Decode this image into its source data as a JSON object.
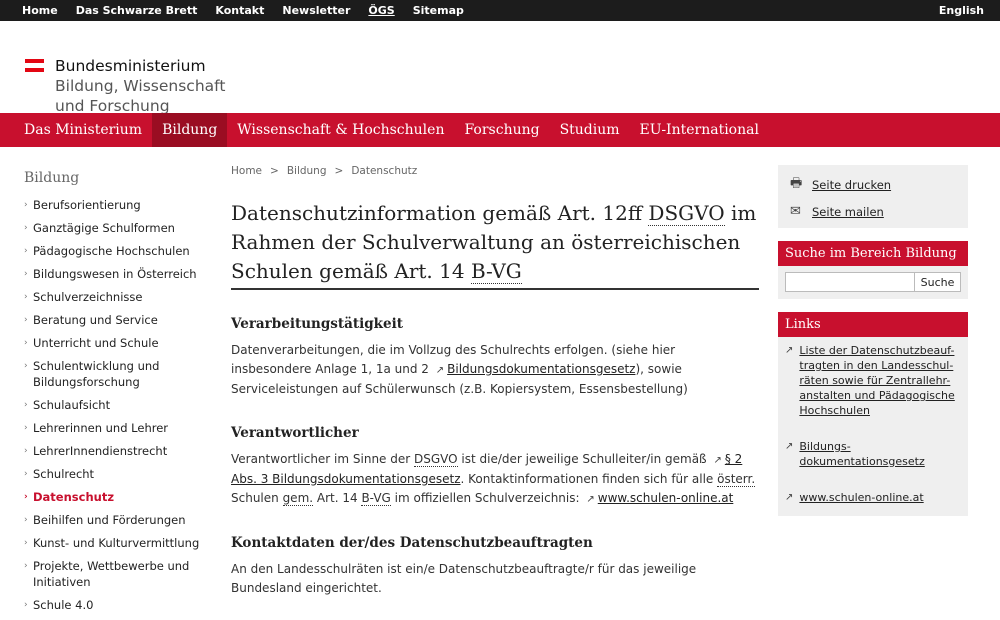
{
  "topbar": {
    "links": [
      "Home",
      "Das Schwarze Brett",
      "Kontakt",
      "Newsletter",
      "ÖGS",
      "Sitemap"
    ],
    "language": "English"
  },
  "logo": {
    "line1": "Bundesministerium",
    "line2": "Bildung, Wissenschaft",
    "line3": "und Forschung"
  },
  "nav": {
    "items": [
      "Das Ministerium",
      "Bildung",
      "Wissenschaft & Hochschulen",
      "Forschung",
      "Studium",
      "EU-International"
    ],
    "active": "Bildung"
  },
  "sidebar": {
    "heading": "Bildung",
    "items": [
      "Berufsorientierung",
      "Ganztägige Schulformen",
      "Pädagogische Hochschulen",
      "Bildungswesen in Österreich",
      "Schulverzeichnisse",
      "Beratung und Service",
      "Unterricht und Schule",
      "Schulentwicklung und Bildungsforschung",
      "Schulaufsicht",
      "Lehrerinnen und Lehrer",
      "LehrerInnendienstrecht",
      "Schulrecht",
      "Datenschutz",
      "Beihilfen und Förderungen",
      "Kunst- und Kulturvermittlung",
      "Projekte, Wettbewerbe und Initiativen",
      "Schule 4.0"
    ],
    "active": "Datenschutz"
  },
  "breadcrumb": [
    "Home",
    "Bildung",
    "Datenschutz"
  ],
  "title": {
    "part1": "Datenschutzinformation gemäß Art. 12ff ",
    "abbr1": "DSGVO",
    "part2": " im Rahmen der Schulverwaltung an österreichischen Schulen gemäß Art. 14 ",
    "abbr2": "B-VG"
  },
  "sections": {
    "s1": {
      "heading": "Verarbeitungstätigkeit",
      "text1": "Datenverarbeitungen, die im Vollzug des Schulrechts erfolgen. (siehe hier insbesondere Anlage 1, 1a und 2 ",
      "link": "Bildungsdokumentationsgesetz",
      "text2": "), sowie Serviceleistungen auf Schülerwunsch (z.B. Kopiersystem, Essensbestellung)"
    },
    "s2": {
      "heading": "Verantwortlicher",
      "text1": "Verantwortlicher im Sinne der ",
      "abbr1": "DSGVO",
      "text2": " ist die/der jeweilige Schulleiter/in gemäß ",
      "link1": "§ 2 Abs. 3 Bildungsdokumentationsgesetz",
      "text3": ". Kontaktinformationen finden sich für alle ",
      "abbr2": "österr.",
      "text4": " Schulen ",
      "abbr3": "gem.",
      "text5": " Art. 14 ",
      "abbr4": "B-VG",
      "text6": " im offiziellen Schulverzeichnis: ",
      "link2": "www.schulen-online.at"
    },
    "s3": {
      "heading": "Kontaktdaten der/des Datenschutzbeauftragten",
      "text": "An den Landesschulräten ist ein/e Datenschutzbeauftragte/r für das jeweilige Bundesland eingerichtet."
    }
  },
  "tools": {
    "print": "Seite drucken",
    "mail": "Seite mailen"
  },
  "search": {
    "heading": "Suche im Bereich Bildung",
    "value": "",
    "button": "Suche"
  },
  "links": {
    "heading": "Links",
    "items": [
      "Liste der Datenschutzbeauf-tragten in den Landesschul-räten sowie für Zentrallehr-anstalten und Pädagogische Hochschulen",
      "Bildungs-dokumentationsgesetz",
      "www.schulen-online.at"
    ]
  },
  "colors": {
    "brand_red": "#c8102e",
    "active_nav": "#9a0d22",
    "topbar": "#1c1c1c"
  }
}
